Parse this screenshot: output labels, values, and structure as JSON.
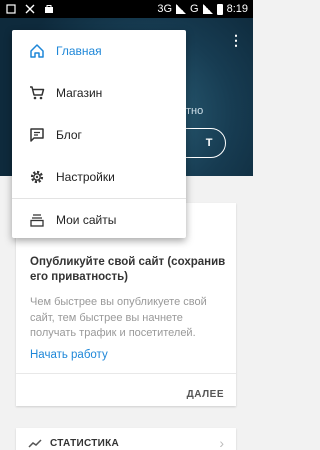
{
  "status_bar": {
    "network": "3G",
    "network2": "G",
    "time": "8:19"
  },
  "hero": {
    "partial_text": "тно",
    "button_label": "Т"
  },
  "card": {
    "title": "Опубликуйте свой сайт (сохранив его приватность)",
    "body": "Чем быстрее вы опубликуете свой сайт, тем быстрее вы начнете получать трафик и посетителей.",
    "link": "Начать работу",
    "next": "ДАЛЕЕ"
  },
  "stats": {
    "label": "СТАТИСТИКА"
  },
  "drawer": {
    "items": [
      {
        "label": "Главная",
        "icon": "home-icon"
      },
      {
        "label": "Магазин",
        "icon": "cart-icon"
      },
      {
        "label": "Блог",
        "icon": "chat-icon"
      },
      {
        "label": "Настройки",
        "icon": "gear-icon"
      },
      {
        "label": "Мои сайты",
        "icon": "sites-icon"
      }
    ]
  },
  "colors": {
    "accent": "#1e87d8",
    "hero_dark": "#173c52"
  }
}
